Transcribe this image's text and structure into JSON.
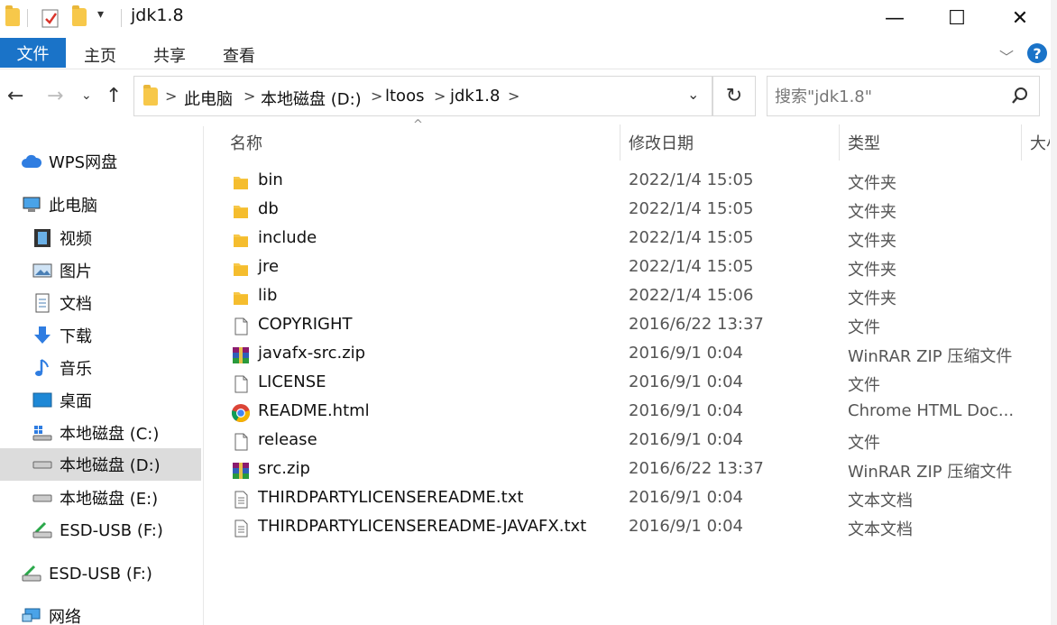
{
  "window": {
    "title": "jdk1.8",
    "minimize": "—",
    "maximize": "☐",
    "close": "✕"
  },
  "ribbon": {
    "file_tab": "文件",
    "tabs": [
      "主页",
      "共享",
      "查看"
    ],
    "help": "?"
  },
  "address": {
    "crumbs": [
      "此电脑",
      "本地磁盘 (D:)",
      "ltoos",
      "jdk1.8"
    ]
  },
  "search": {
    "placeholder": "搜索\"jdk1.8\""
  },
  "sidebar": {
    "items": [
      {
        "label": "WPS网盘",
        "icon": "cloud-icon"
      },
      {
        "label": "此电脑",
        "icon": "computer-icon"
      },
      {
        "label": "视频",
        "icon": "video-icon"
      },
      {
        "label": "图片",
        "icon": "pictures-icon"
      },
      {
        "label": "文档",
        "icon": "documents-icon"
      },
      {
        "label": "下载",
        "icon": "download-icon"
      },
      {
        "label": "音乐",
        "icon": "music-icon"
      },
      {
        "label": "桌面",
        "icon": "desktop-icon"
      },
      {
        "label": "本地磁盘 (C:)",
        "icon": "windows-drive-icon"
      },
      {
        "label": "本地磁盘 (D:)",
        "icon": "drive-icon"
      },
      {
        "label": "本地磁盘 (E:)",
        "icon": "drive-icon"
      },
      {
        "label": "ESD-USB (F:)",
        "icon": "usb-drive-icon"
      },
      {
        "label": "ESD-USB (F:)",
        "icon": "usb-drive-icon"
      },
      {
        "label": "网络",
        "icon": "network-icon"
      }
    ]
  },
  "columns": {
    "name": "名称",
    "date": "修改日期",
    "type": "类型",
    "size": "大小"
  },
  "files": [
    {
      "name": "bin",
      "date": "2022/1/4 15:05",
      "type": "文件夹",
      "icon": "folder-icon"
    },
    {
      "name": "db",
      "date": "2022/1/4 15:05",
      "type": "文件夹",
      "icon": "folder-icon"
    },
    {
      "name": "include",
      "date": "2022/1/4 15:05",
      "type": "文件夹",
      "icon": "folder-icon"
    },
    {
      "name": "jre",
      "date": "2022/1/4 15:05",
      "type": "文件夹",
      "icon": "folder-icon"
    },
    {
      "name": "lib",
      "date": "2022/1/4 15:06",
      "type": "文件夹",
      "icon": "folder-icon"
    },
    {
      "name": "COPYRIGHT",
      "date": "2016/6/22 13:37",
      "type": "文件",
      "icon": "file-icon"
    },
    {
      "name": "javafx-src.zip",
      "date": "2016/9/1 0:04",
      "type": "WinRAR ZIP 压缩文件",
      "icon": "winrar-icon"
    },
    {
      "name": "LICENSE",
      "date": "2016/9/1 0:04",
      "type": "文件",
      "icon": "file-icon"
    },
    {
      "name": "README.html",
      "date": "2016/9/1 0:04",
      "type": "Chrome HTML Doc...",
      "icon": "chrome-icon"
    },
    {
      "name": "release",
      "date": "2016/9/1 0:04",
      "type": "文件",
      "icon": "file-icon"
    },
    {
      "name": "src.zip",
      "date": "2016/6/22 13:37",
      "type": "WinRAR ZIP 压缩文件",
      "icon": "winrar-icon"
    },
    {
      "name": "THIRDPARTYLICENSEREADME.txt",
      "date": "2016/9/1 0:04",
      "type": "文本文档",
      "icon": "text-file-icon"
    },
    {
      "name": "THIRDPARTYLICENSEREADME-JAVAFX.txt",
      "date": "2016/9/1 0:04",
      "type": "文本文档",
      "icon": "text-file-icon"
    }
  ]
}
